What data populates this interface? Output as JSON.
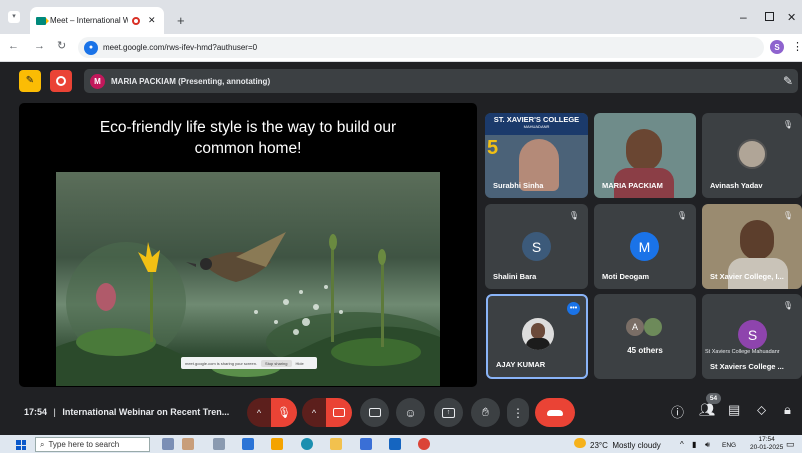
{
  "browser": {
    "tab_title": "Meet – International Webin",
    "url": "meet.google.com/rws-ifev-hmd?authuser=0",
    "profile_initial": "S"
  },
  "presentation_bar": {
    "presenter_initial": "M",
    "presenter_label": "MARIA PACKIAM (Presenting, annotating)"
  },
  "slide": {
    "title": "Eco-friendly life style is the way to build our\ncommon home!",
    "share_text": "meet.google.com is sharing your screen.",
    "stop_label": "Stop sharing",
    "hide_label": "Hide"
  },
  "participants": [
    {
      "name": "Surabhi Sinha",
      "type": "video",
      "banner": "ST. XAVIER'S COLLEGE",
      "banner_sub": "MAHUADANR"
    },
    {
      "name": "MARIA PACKIAM",
      "type": "video"
    },
    {
      "name": "Avinash Yadav",
      "type": "photo"
    },
    {
      "name": "Shalini Bara",
      "type": "initial",
      "initial": "S",
      "color": "#3c5a7a"
    },
    {
      "name": "Moti Deogam",
      "type": "initial",
      "initial": "M",
      "color": "#1a73e8"
    },
    {
      "name": "St Xavier College, I...",
      "type": "video"
    },
    {
      "name": "AJAY KUMAR",
      "type": "photo"
    },
    {
      "name": "45 others",
      "type": "others",
      "initial": "A"
    },
    {
      "name": "St Xaviers College ...",
      "type": "initial",
      "initial": "S",
      "color": "#8e44ad",
      "subtitle": "St Xaviers College Mahuadanr"
    }
  ],
  "meeting": {
    "time": "17:54",
    "title": "International Webinar on Recent Tren...",
    "people_count": "54"
  },
  "taskbar": {
    "search_placeholder": "Type here to search",
    "weather": "23°C  Mostly cloudy",
    "lang": "ENG",
    "clock_time": "17:54",
    "clock_date": "20-01-2025"
  },
  "colors": {
    "meet_bg": "#202124",
    "tile_bg": "#3c4043",
    "end_call": "#ea4335",
    "muted_red": "#5c1f1c",
    "presenter_avatar": "#c2185b"
  }
}
